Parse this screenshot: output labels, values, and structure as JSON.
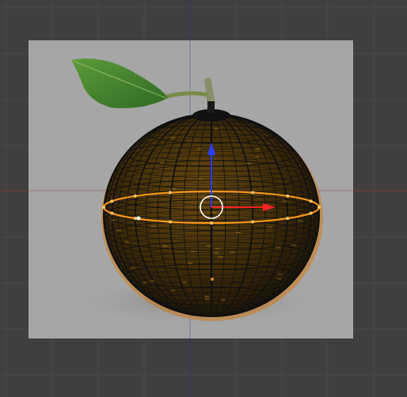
{
  "viewport": {
    "background_color": "#3f3f3f",
    "grid_color": "#4a4a4a",
    "x_axis_color": "#7a2f2f",
    "z_axis_color": "#2f2f8a"
  },
  "reference_image": {
    "background_color": "#a6a6a6",
    "subject": "orange"
  },
  "mesh": {
    "wire_color": "#111111",
    "surface_color": "#c98a1a",
    "selected_loop_color": "#ff9a1a",
    "selected_vertex_color": "#ffcc66"
  },
  "transform_gizmo": {
    "x_arrow_color": "#ff2222",
    "z_arrow_color": "#2a3cff",
    "center_circle_color": "#ffffff"
  },
  "icons": [
    "3d-cursor-icon",
    "move-gizmo-icon"
  ]
}
